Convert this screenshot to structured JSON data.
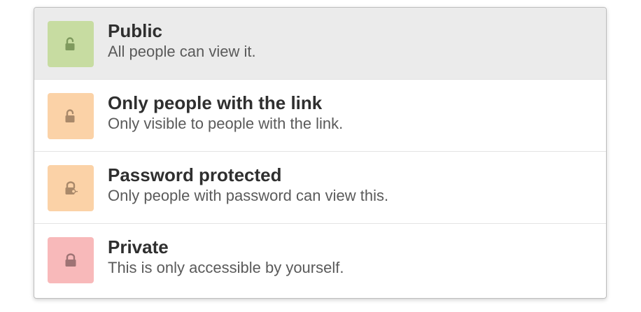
{
  "options": [
    {
      "title": "Public",
      "description": "All people can view it.",
      "icon": "unlocked-padlock-icon",
      "color": "#c7dca1",
      "icon_color": "#7f9a5e",
      "selected": true
    },
    {
      "title": "Only people with the link",
      "description": "Only visible to people with the link.",
      "icon": "unlocked-padlock-icon",
      "color": "#fbd2a7",
      "icon_color": "#a9896a",
      "selected": false
    },
    {
      "title": "Password protected",
      "description": "Only people with password can view this.",
      "icon": "padlock-key-icon",
      "color": "#fbd2a7",
      "icon_color": "#a9896a",
      "selected": false
    },
    {
      "title": "Private",
      "description": "This is only accessible by yourself.",
      "icon": "locked-padlock-icon",
      "color": "#f8b9ba",
      "icon_color": "#9e7374",
      "selected": false
    }
  ]
}
